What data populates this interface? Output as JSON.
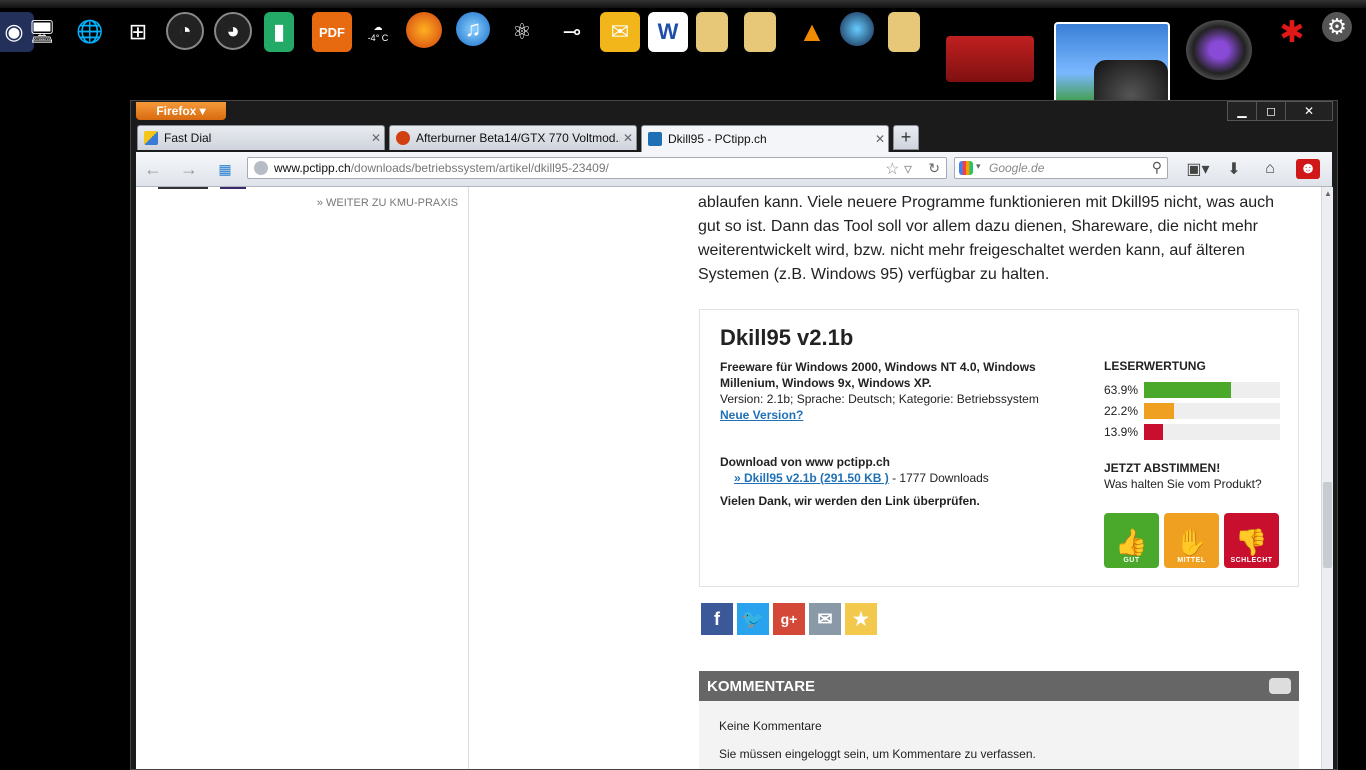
{
  "dock": {
    "icons": [
      "network-icon",
      "computer-icon",
      "windows-icon",
      "gauge-icon",
      "gauge-icon",
      "battery-icon",
      "pdf-icon",
      "weather-icon",
      "firefox-icon",
      "itunes-icon",
      "globe-icon",
      "key-icon",
      "outlook-icon",
      "word-icon",
      "folder-icon",
      "drive-icon",
      "vlc-icon",
      "google-earth-icon",
      "folder-icon",
      "book-icon",
      "photo-icon",
      "camera-icon",
      "lens-icon",
      "puzzle-icon",
      "settings-icon"
    ],
    "weather_temp": "-4° C",
    "pdf_label": "PDF",
    "word_label": "W"
  },
  "browser": {
    "menu_label": "Firefox",
    "tabs": [
      {
        "label": "Fast Dial",
        "active": false
      },
      {
        "label": "Afterburner Beta14/GTX 770 Voltmod...",
        "active": false
      },
      {
        "label": "Dkill95 - PCtipp.ch",
        "active": true
      }
    ],
    "url_domain": "www.pctipp.ch",
    "url_path": "/downloads/betriebssystem/artikel/dkill95-23409/",
    "search_placeholder": "Google.de"
  },
  "page": {
    "kmu_link": "» WEITER ZU KMU-PRAXIS",
    "article_text": "ablaufen kann. Viele neuere Programme funktionieren mit Dkill95 nicht, was auch gut so ist. Dann das Tool soll vor allem dazu dienen, Shareware, die nicht mehr weiterentwickelt wird, bzw. nicht mehr freigeschaltet werden kann, auf älteren Systemen (z.B. Windows 95) verfügbar zu halten.",
    "download": {
      "title": "Dkill95 v2.1b",
      "license": "Freeware für Windows 2000, Windows NT 4.0, Windows Millenium, Windows 9x, Windows XP.",
      "details": "Version: 2.1b; Sprache: Deutsch; Kategorie: Betriebssystem",
      "new_version_link": "Neue Version?",
      "download_from": "Download von www pctipp.ch",
      "file_link": "» Dkill95 v2.1b (291.50 KB )",
      "downloads_count": " - 1777 Downloads",
      "thanks": "Vielen Dank, wir werden den Link überprüfen."
    },
    "rating": {
      "heading": "LESERWERTUNG",
      "rows": [
        {
          "pct_label": "63.9%",
          "value": 0.639,
          "color": "#4aa82a"
        },
        {
          "pct_label": "22.2%",
          "value": 0.222,
          "color": "#f0a020"
        },
        {
          "pct_label": "13.9%",
          "value": 0.139,
          "color": "#c8102e"
        }
      ],
      "vote_heading": "JETZT ABSTIMMEN!",
      "vote_question": "Was halten Sie vom Produkt?",
      "vote_buttons": [
        {
          "label": "GUT",
          "color": "#4aa82a"
        },
        {
          "label": "MITTEL",
          "color": "#f0a020"
        },
        {
          "label": "SCHLECHT",
          "color": "#c8102e"
        }
      ]
    },
    "social": [
      "facebook-icon",
      "twitter-icon",
      "google-plus-icon",
      "email-icon",
      "favorite-icon"
    ],
    "comments": {
      "heading": "KOMMENTARE",
      "none": "Keine Kommentare",
      "login_note": "Sie müssen eingeloggt sein, um Kommentare zu verfassen."
    }
  }
}
